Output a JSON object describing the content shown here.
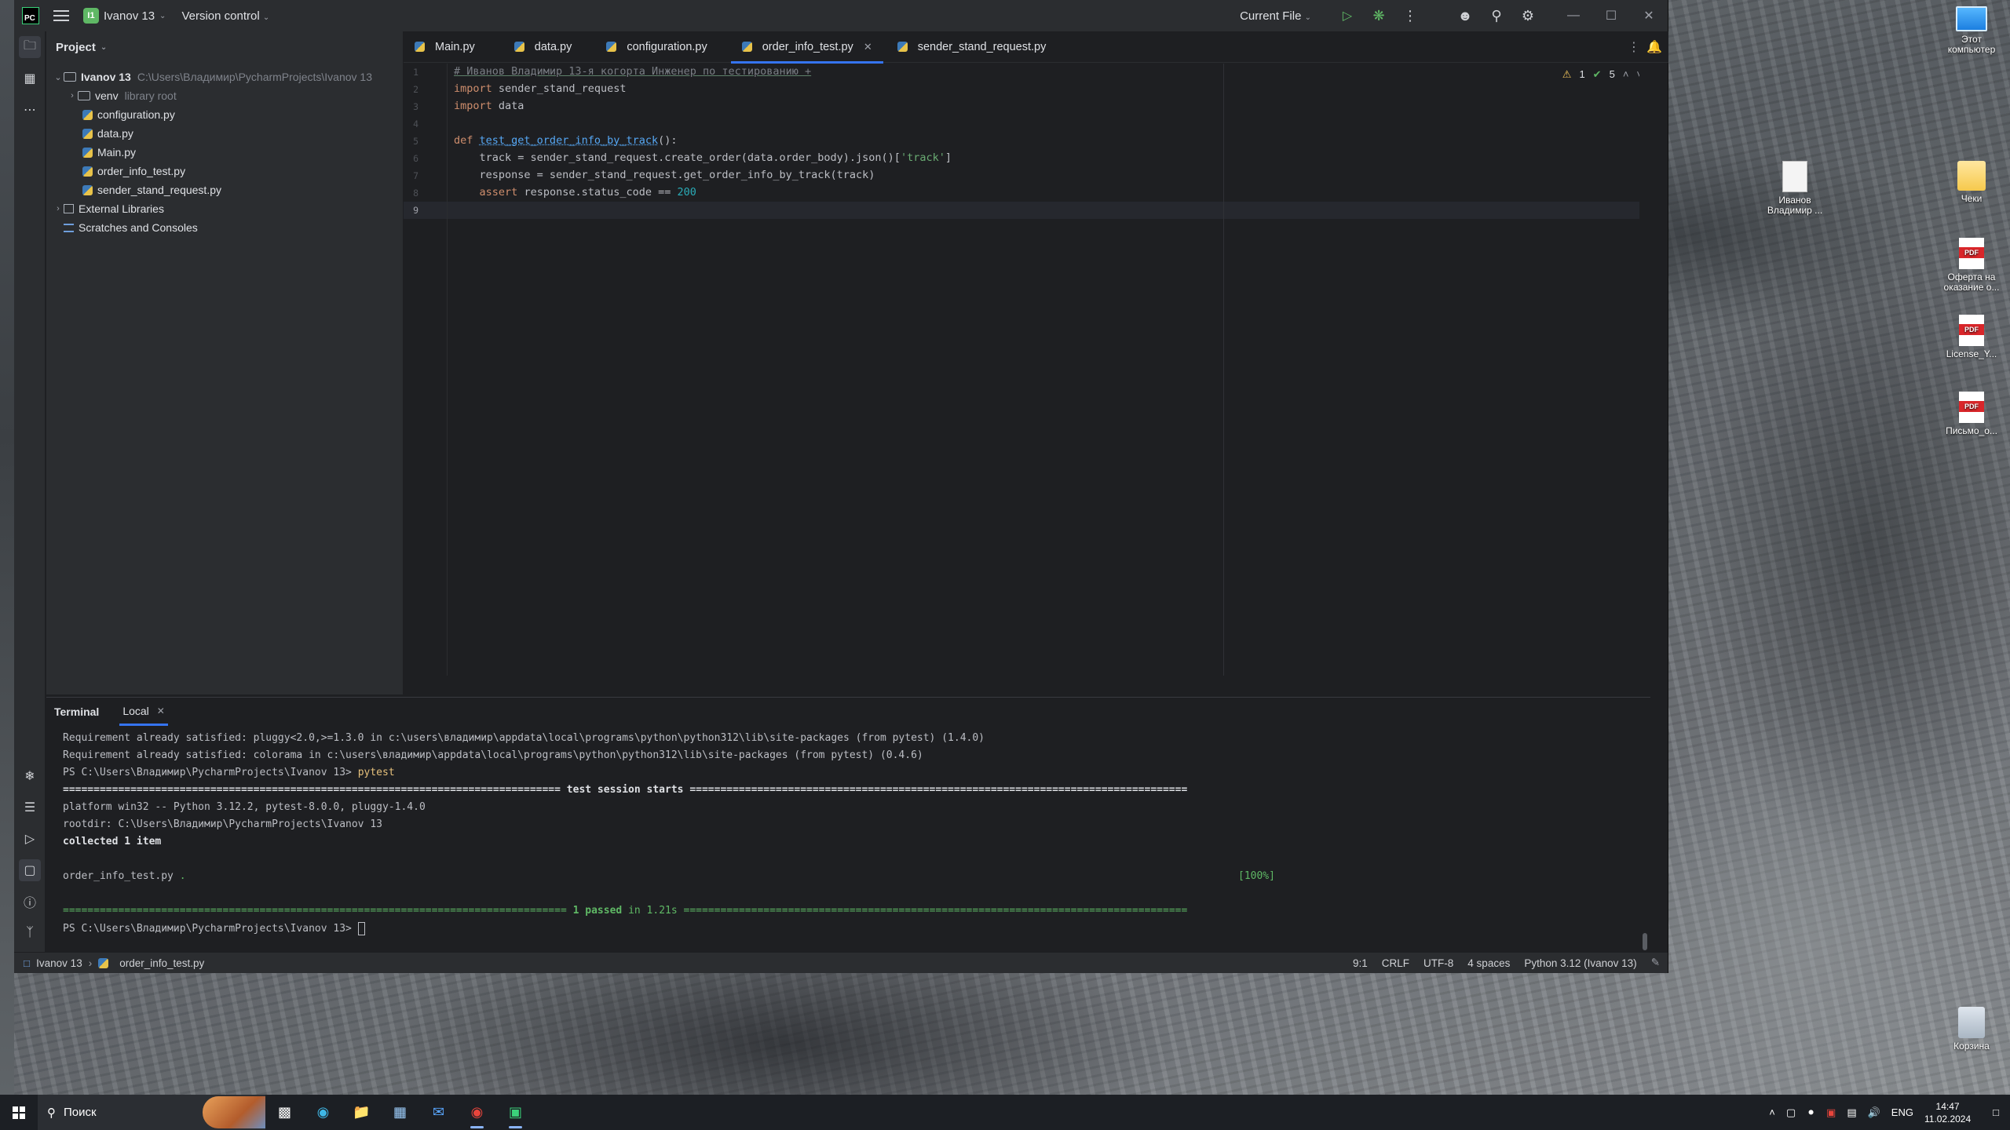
{
  "ide": {
    "project_name": "Ivanov 13",
    "project_badge": "I1",
    "vcs_label": "Version control",
    "run_config": "Current File",
    "project_panel_title": "Project",
    "tree": [
      {
        "label": "Ivanov 13",
        "hint": "C:\\Users\\Владимир\\PycharmProjects\\Ivanov 13",
        "kind": "root"
      },
      {
        "label": "venv",
        "hint": "library root",
        "kind": "folder"
      },
      {
        "label": "configuration.py",
        "kind": "py"
      },
      {
        "label": "data.py",
        "kind": "py"
      },
      {
        "label": "Main.py",
        "kind": "py"
      },
      {
        "label": "order_info_test.py",
        "kind": "py"
      },
      {
        "label": "sender_stand_request.py",
        "kind": "py"
      },
      {
        "label": "External Libraries",
        "kind": "lib"
      },
      {
        "label": "Scratches and Consoles",
        "kind": "scratch"
      }
    ],
    "tabs": [
      "Main.py",
      "data.py",
      "configuration.py",
      "order_info_test.py",
      "sender_stand_request.py"
    ],
    "active_tab": "order_info_test.py",
    "inspections": {
      "warnings": "1",
      "ok": "5"
    },
    "code": {
      "comment": "# Иванов Владимир 13-я когорта Инженер по тестированию +",
      "import1": "sender_stand_request",
      "import2": "data",
      "def_name": "test_get_order_info_by_track",
      "line6_a": "    track = sender_stand_request.create_order(data.order_body).json()[",
      "line6_str": "'track'",
      "line6_b": "]",
      "line7": "    response = sender_stand_request.get_order_info_by_track(track)",
      "line8_a": "response.status_code == ",
      "line8_num": "200",
      "kw_import": "import",
      "kw_def": "def",
      "kw_assert": "assert",
      "def_tail": "():"
    },
    "line_numbers": [
      "1",
      "2",
      "3",
      "4",
      "5",
      "6",
      "7",
      "8",
      "9"
    ],
    "terminal": {
      "title": "Terminal",
      "tab": "Local",
      "lines": {
        "l1": "Requirement already satisfied: pluggy<2.0,>=1.3.0 in c:\\users\\владимир\\appdata\\local\\programs\\python\\python312\\lib\\site-packages (from pytest) (1.4.0)",
        "l2": "Requirement already satisfied: colorama in c:\\users\\владимир\\appdata\\local\\programs\\python\\python312\\lib\\site-packages (from pytest) (0.4.6)",
        "l3_prompt": "PS C:\\Users\\Владимир\\PycharmProjects\\Ivanov 13> ",
        "l3_cmd": "pytest",
        "l4": "================================================================================= test session starts =================================================================================",
        "l5": "platform win32 -- Python 3.12.2, pytest-8.0.0, pluggy-1.4.0",
        "l6": "rootdir: C:\\Users\\Владимир\\PycharmProjects\\Ivanov 13",
        "l7": "collected 1 item",
        "l8_file": "order_info_test.py ",
        "l8_dot": ".",
        "l8_pct": "[100%]",
        "l9_eq_left": "================================================================================== ",
        "l9_passed": "1 passed",
        "l9_time": " in 1.21s ",
        "l9_eq_right": "==================================================================================",
        "l10": "PS C:\\Users\\Владимир\\PycharmProjects\\Ivanov 13> "
      }
    },
    "status": {
      "crumb_project": "Ivanov 13",
      "crumb_file": "order_info_test.py",
      "position": "9:1",
      "line_sep": "CRLF",
      "encoding": "UTF-8",
      "indent": "4 spaces",
      "interpreter": "Python 3.12 (Ivanov 13)"
    }
  },
  "desktop": {
    "icons": [
      {
        "label": "Этот компьютер",
        "type": "pc"
      },
      {
        "label": "Иванов Владимир ...",
        "type": "doc"
      },
      {
        "label": "Чеки",
        "type": "folder"
      },
      {
        "label": "Оферта на оказание о...",
        "type": "pdf"
      },
      {
        "label": "License_Y...",
        "type": "pdf"
      },
      {
        "label": "Письмо_о...",
        "type": "pdf"
      },
      {
        "label": "Корзина",
        "type": "bin"
      }
    ],
    "pdf_tag": "PDF"
  },
  "taskbar": {
    "search_placeholder": "Поиск",
    "lang": "ENG",
    "time": "14:47",
    "date": "11.02.2024"
  }
}
